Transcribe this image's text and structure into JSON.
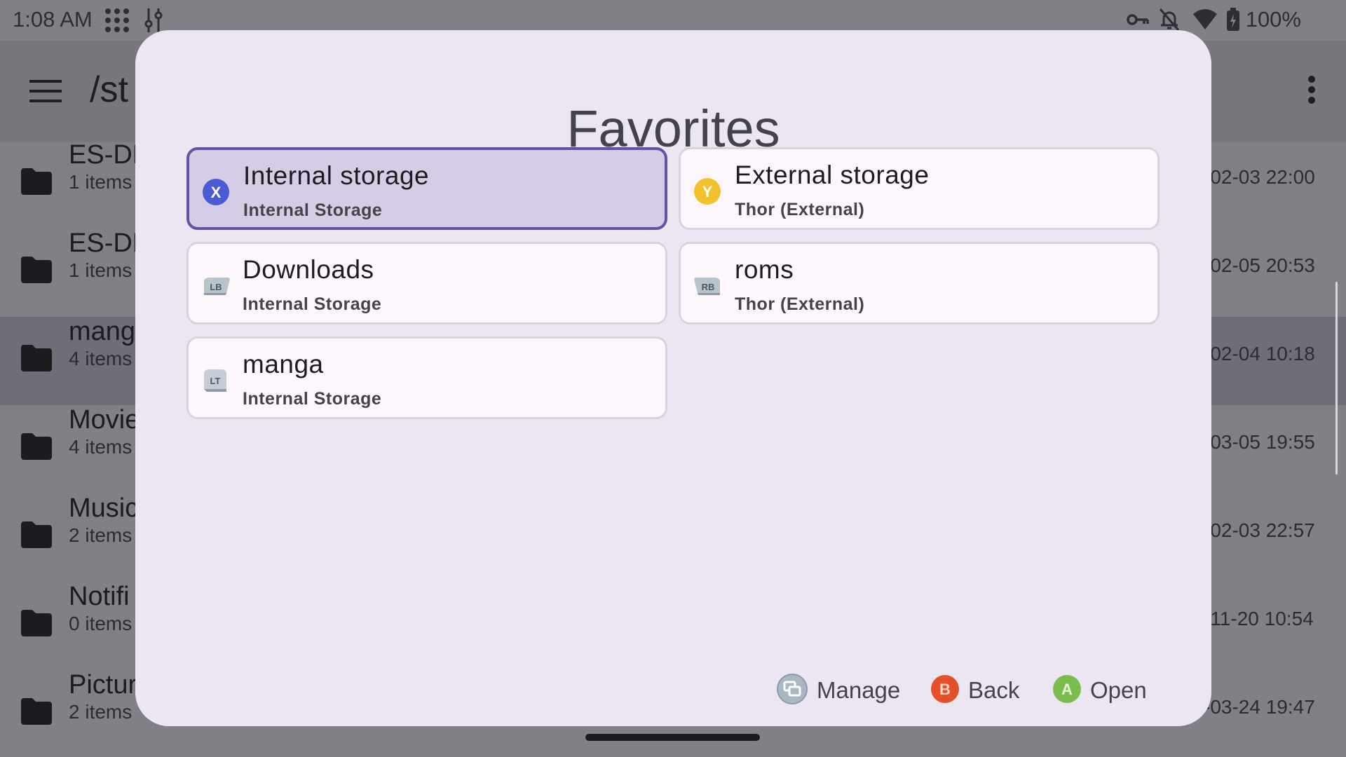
{
  "status_bar": {
    "time": "1:08 AM",
    "battery": "100%",
    "icons": [
      "app-grid-icon",
      "sliders-icon",
      "vpn-key-icon",
      "bell-off-icon",
      "wifi-icon",
      "battery-charging-icon"
    ]
  },
  "app_bar": {
    "path": "/st",
    "menu_icon": "hamburger-menu-icon",
    "overflow_icon": "more-vert-icon"
  },
  "files": [
    {
      "name": "ES-DE",
      "count": "1 items",
      "date": "-02-03 22:00"
    },
    {
      "name": "ES-DE",
      "count": "1 items",
      "date": "-02-05 20:53"
    },
    {
      "name": "mang",
      "count": "4 items",
      "date": "-02-04 10:18",
      "selected": true
    },
    {
      "name": "Movie",
      "count": "4 items",
      "date": "-03-05 19:55"
    },
    {
      "name": "Music",
      "count": "2 items",
      "date": "-02-03 22:57"
    },
    {
      "name": "Notifi",
      "count": "0 items",
      "date": "-11-20 10:54"
    },
    {
      "name": "Pictur",
      "count": "2 items",
      "date": "-03-24 19:47"
    }
  ],
  "dialog": {
    "title": "Favorites",
    "favorites": [
      {
        "name": "Internal storage",
        "sub": "Internal Storage",
        "badge": "X",
        "badge_color": "#4a5bd4",
        "active": true
      },
      {
        "name": "External storage",
        "sub": "Thor (External)",
        "badge": "Y",
        "badge_color": "#f3c12a"
      },
      {
        "name": "Downloads",
        "sub": "Internal Storage",
        "badge": "LB"
      },
      {
        "name": "roms",
        "sub": "Thor (External)",
        "badge": "RB"
      },
      {
        "name": "manga",
        "sub": "Internal Storage",
        "badge": "LT"
      }
    ],
    "buttons": [
      {
        "key": "view",
        "label": "Manage",
        "color": "#aab8c6"
      },
      {
        "key": "B",
        "label": "Back",
        "color": "#e4502a"
      },
      {
        "key": "A",
        "label": "Open",
        "color": "#7cbc4e"
      }
    ]
  },
  "colors": {
    "accent": "#6751a4",
    "dialog_bg": "#ece6f3",
    "card_bg": "#fdf7fd"
  }
}
